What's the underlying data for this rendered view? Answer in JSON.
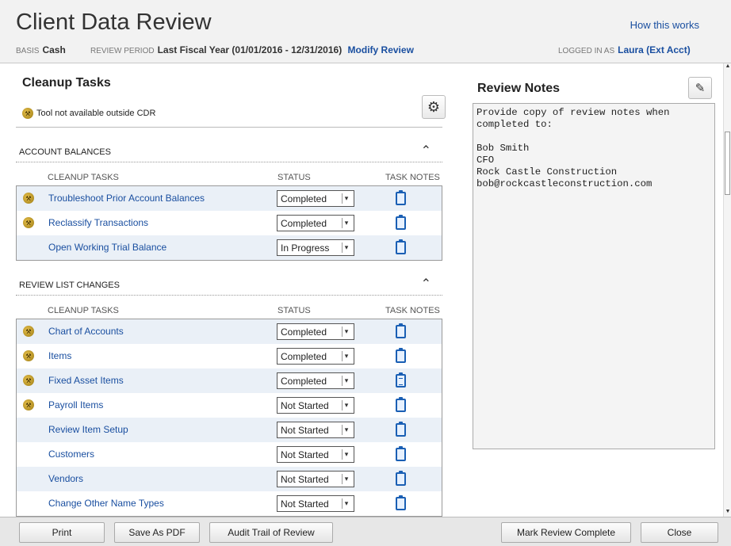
{
  "header": {
    "title": "Client Data Review",
    "how_link": "How this works",
    "basis_label": "BASIS",
    "basis_value": "Cash",
    "period_label": "REVIEW PERIOD",
    "period_value": "Last Fiscal Year (01/01/2016 - 12/31/2016)",
    "modify_link": "Modify Review",
    "logged_label": "LOGGED IN AS",
    "logged_value": "Laura (Ext Acct)"
  },
  "cleanup": {
    "title": "Cleanup Tasks",
    "notice": "Tool not available outside CDR",
    "col_tasks": "CLEANUP TASKS",
    "col_status": "STATUS",
    "col_notes": "TASK NOTES",
    "groups": [
      {
        "name": "ACCOUNT BALANCES",
        "tasks": [
          {
            "label": "Troubleshoot Prior Account Balances",
            "status": "Completed",
            "tool_icon": true,
            "notes_filled": false
          },
          {
            "label": "Reclassify Transactions",
            "status": "Completed",
            "tool_icon": true,
            "notes_filled": false
          },
          {
            "label": "Open Working Trial Balance",
            "status": "In Progress",
            "tool_icon": false,
            "notes_filled": false
          }
        ]
      },
      {
        "name": "REVIEW LIST CHANGES",
        "tasks": [
          {
            "label": "Chart of Accounts",
            "status": "Completed",
            "tool_icon": true,
            "notes_filled": false
          },
          {
            "label": "Items",
            "status": "Completed",
            "tool_icon": true,
            "notes_filled": false
          },
          {
            "label": "Fixed Asset Items",
            "status": "Completed",
            "tool_icon": true,
            "notes_filled": true
          },
          {
            "label": "Payroll Items",
            "status": "Not Started",
            "tool_icon": true,
            "notes_filled": false
          },
          {
            "label": "Review Item Setup",
            "status": "Not Started",
            "tool_icon": false,
            "notes_filled": false
          },
          {
            "label": "Customers",
            "status": "Not Started",
            "tool_icon": false,
            "notes_filled": false
          },
          {
            "label": "Vendors",
            "status": "Not Started",
            "tool_icon": false,
            "notes_filled": false
          },
          {
            "label": "Change Other Name Types",
            "status": "Not Started",
            "tool_icon": false,
            "notes_filled": false
          }
        ]
      }
    ]
  },
  "review_notes": {
    "title": "Review Notes",
    "text": "Provide copy of review notes when\ncompleted to:\n\nBob Smith\nCFO\nRock Castle Construction\nbob@rockcastleconstruction.com"
  },
  "footer": {
    "print": "Print",
    "save_pdf": "Save As PDF",
    "audit_trail": "Audit Trail of Review",
    "mark_complete": "Mark Review Complete",
    "close": "Close"
  },
  "icons": {
    "gear": "gear-icon",
    "pencil": "pencil-icon",
    "tool": "tool-icon",
    "note": "clipboard-icon",
    "caret": "chevron-up-icon"
  }
}
